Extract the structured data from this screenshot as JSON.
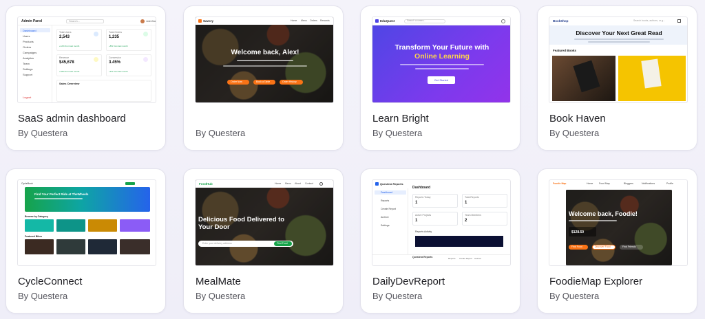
{
  "cards": [
    {
      "title": "SaaS admin dashboard",
      "author": "By Questera",
      "preview": {
        "brand": "Admin Panel",
        "search_placeholder": "Search...",
        "user": "John Doe",
        "nav": [
          "Dashboard",
          "Users",
          "Products",
          "Orders",
          "Campaigns",
          "Analytics",
          "Team",
          "Settings",
          "Support"
        ],
        "logout": "Logout",
        "stats": [
          {
            "label": "Total Users",
            "value": "2,543",
            "delta": "+12% from last month",
            "icon_color": "#3b82f6"
          },
          {
            "label": "Total Orders",
            "value": "1,235",
            "delta": "+8% from last month",
            "icon_color": "#22c55e"
          },
          {
            "label": "Revenue",
            "value": "$45,678",
            "delta": "+18% from last month",
            "icon_color": "#eab308"
          },
          {
            "label": "Conversion",
            "value": "3.45%",
            "delta": "+4% from last month",
            "icon_color": "#a855f7"
          }
        ],
        "chart_title": "Sales Overview"
      }
    },
    {
      "title": "",
      "author": "By Questera",
      "preview": {
        "brand": "Savory",
        "nav": [
          "Home",
          "Menu",
          "Orders",
          "Rewards"
        ],
        "headline": "Welcome back, Alex!",
        "buttons": [
          "Order Now",
          "Book a Table",
          "Order History"
        ],
        "accent": "#f97316"
      }
    },
    {
      "title": "Learn Bright",
      "author": "By Questera",
      "preview": {
        "brand": "EduQuest",
        "search_placeholder": "Search courses...",
        "headline_line1": "Transform Your Future with",
        "headline_line2": "Online Learning",
        "button": "Get Started",
        "accent": "#7c3aed"
      }
    },
    {
      "title": "Book Haven",
      "author": "By Questera",
      "preview": {
        "brand": "BookShop",
        "search_placeholder": "Search books, authors, or g...",
        "headline": "Discover Your Next Great Read",
        "section": "Featured Books"
      }
    },
    {
      "title": "CycleConnect",
      "author": "By Questera",
      "preview": {
        "brand": "CycleBook",
        "headline": "Find Your Perfect Ride at TheWheels",
        "categories_label": "Browse by Category",
        "featured_label": "Featured Bikes",
        "category_colors": [
          "#14b8a6",
          "#0d9488",
          "#ca8a04",
          "#8b5cf6"
        ]
      }
    },
    {
      "title": "MealMate",
      "author": "By Questera",
      "preview": {
        "brand": "FoodHub",
        "nav": [
          "Home",
          "Menu",
          "About",
          "Contact"
        ],
        "headline_line1": "Delicious Food Delivered to",
        "headline_line2": "Your Door",
        "input_placeholder": "Enter your delivery address",
        "button": "Find Food",
        "accent": "#16a34a"
      }
    },
    {
      "title": "DailyDevReport",
      "author": "By Questera",
      "preview": {
        "brand": "Questera Reports",
        "nav": [
          "Dashboard",
          "Reports",
          "Create Report",
          "Archive",
          "Settings"
        ],
        "page_title": "Dashboard",
        "stats": [
          {
            "label": "Reports Today",
            "value": "1"
          },
          {
            "label": "Total Reports",
            "value": "1"
          },
          {
            "label": "Active Projects",
            "value": "1"
          },
          {
            "label": "Team Members",
            "value": "2"
          }
        ],
        "activity": "Reports Activity",
        "footer_brand": "Questera Reports",
        "footer_links": [
          "Reports",
          "Create Report",
          "Archive"
        ]
      }
    },
    {
      "title": "FoodieMap Explorer",
      "author": "By Questera",
      "preview": {
        "brand": "Foodie Map",
        "nav": [
          "Home",
          "Food Map",
          "Bloggers",
          "Notifications",
          "Profile"
        ],
        "headline": "Welcome back, Foodie!",
        "price": "$128.50",
        "buttons": [
          "Find Food",
          "Discover Food",
          "Find Friends"
        ],
        "accent": "#f97316"
      }
    }
  ]
}
